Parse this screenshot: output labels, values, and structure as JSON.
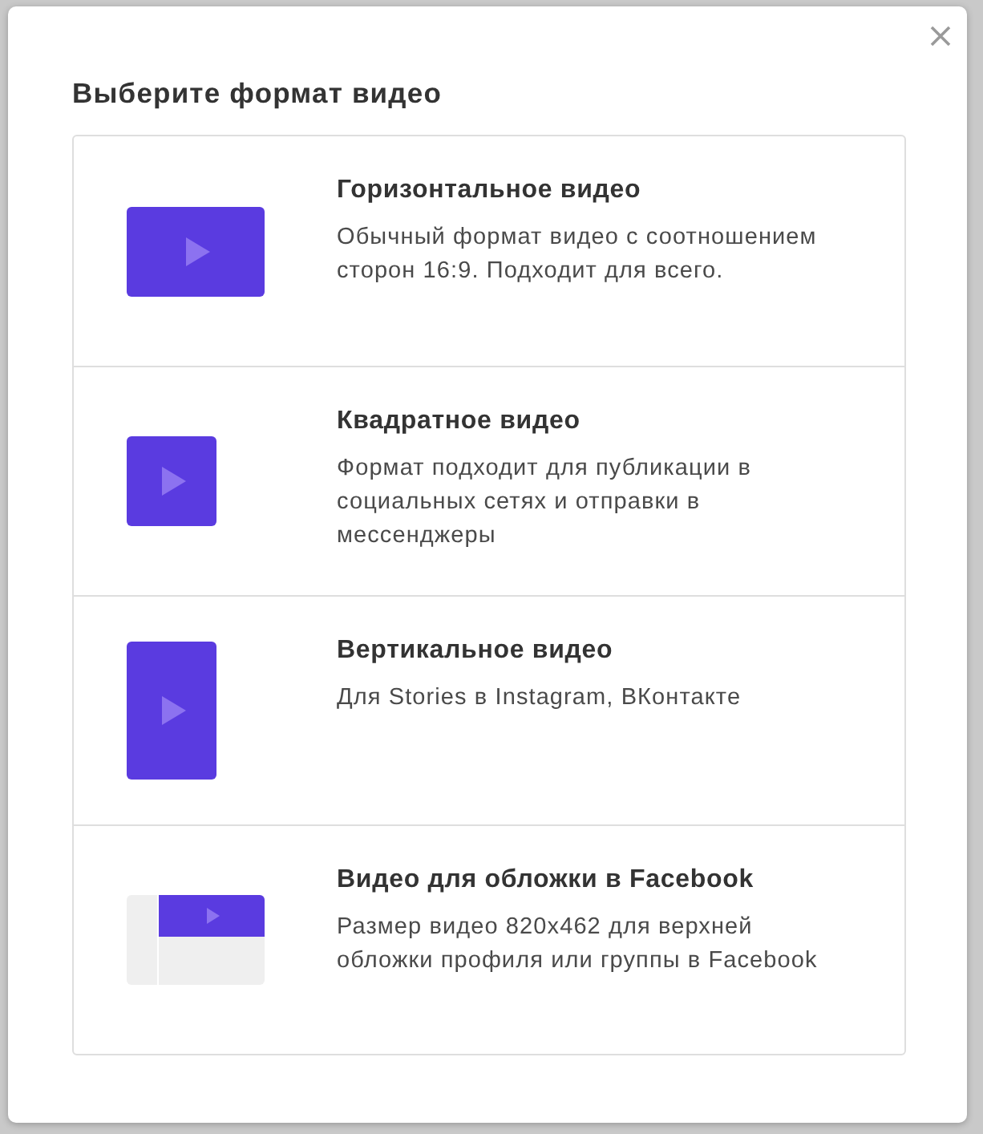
{
  "dialog": {
    "title": "Выберите формат видео"
  },
  "formats": [
    {
      "kind": "horizontal",
      "title": "Горизонтальное видео",
      "description": "Обычный формат видео с соотношением сторон 16:9. Подходит для всего."
    },
    {
      "kind": "square",
      "title": "Квадратное видео",
      "description": "Формат подходит для публикации в социальных сетях и отправки в мессенджеры"
    },
    {
      "kind": "vertical",
      "title": "Вертикальное видео",
      "description": "Для Stories в Instagram, ВКонтакте"
    },
    {
      "kind": "cover",
      "title": "Видео для обложки в Facebook",
      "description": "Размер видео 820x462 для верхней обложки профиля или группы в Facebook"
    }
  ]
}
